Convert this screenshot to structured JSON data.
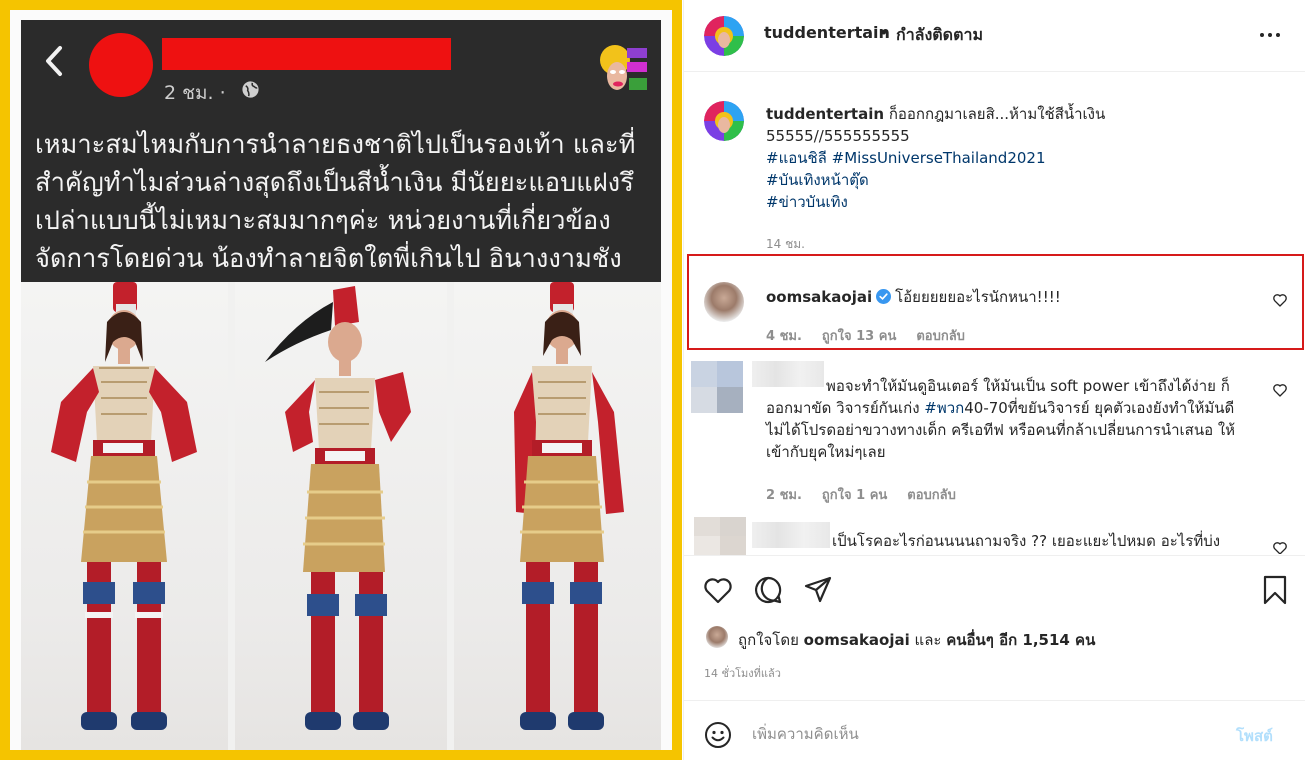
{
  "media": {
    "facebook_post": {
      "time": "2 ชม. ·",
      "text": "เหมาะสมไหมกับการนำลายธงชาติไปเป็นรองเท้า และที่สำคัญทำไมส่วนล่างสุดถึงเป็นสีน้ำเงิน มีนัยยะแอบแฝงรึเปล่าแบบนี้ไม่เหมาะสมมากๆค่ะ หน่วยงานที่เกี่ยวข้องจัดการโดยด่วน น้องทำลายจิตใตพี่เกินไป อินางงามชังชาติ"
    },
    "frame_color": "#f5c400",
    "redaction_color": "#ee1111"
  },
  "header": {
    "username": "tuddentertain",
    "separator": "•",
    "follow_status": "กำลังติดตาม"
  },
  "caption": {
    "username": "tuddentertain",
    "text": "ก็ออกกฎมาเลยสิ...ห้ามใช้สีน้ำเงิน",
    "line2": "55555//555555555",
    "tags": [
      "#แอนชิลี #MissUniverseThailand2021",
      "#บันเทิงหน้าตุ๊ด",
      "#ข่าวบันเทิง"
    ],
    "time": "14 ชม."
  },
  "comments": [
    {
      "username": "oomsakaojai",
      "text": "โอ้ยยยยยอะไรนักหนา!!!!",
      "time": "4 ชม.",
      "likes": "ถูกใจ 13 คน",
      "reply": "ตอบกลับ"
    },
    {
      "text_a": "พอจะทำให้มันดูอินเตอร์ ให้มันเป็น soft power เข้าถึงได้ง่าย ก็ออกมาขัด วิจารย์กันเก่ง ",
      "hashtag": "#พวก",
      "text_b": "40-70ที่ขยันวิจารย์ ยุคตัวเองยังทำให้มันดีไม่ได้โปรดอย่าขวางทางเด็ก ครีเอทีฟ หรือคนที่กล้าเปลี่ยนการนำเสนอ ให้เข้ากับยุคใหม่ๆเลย",
      "time": "2 ชม.",
      "likes": "ถูกใจ 1 คน",
      "reply": "ตอบกลับ"
    },
    {
      "text": "เป็นโรคอะไรก่อนนนนถามจริง ?? เยอะแยะไปหมด อะไรที่บ่ง"
    }
  ],
  "likes": {
    "prefix": "ถูกใจโดย",
    "user": "oomsakaojai",
    "conj": "และ",
    "others": "คนอื่นๆ อีก 1,514 คน"
  },
  "post_time": "14 ชั่วโมงที่แล้ว",
  "comment_box": {
    "placeholder": "เพิ่มความคิดเห็น",
    "post_label": "โพสต์"
  },
  "colors": {
    "link": "#00376b",
    "muted": "#8e8e8e",
    "post_disabled": "#b2dffc",
    "highlight_border": "#d61a1a"
  }
}
